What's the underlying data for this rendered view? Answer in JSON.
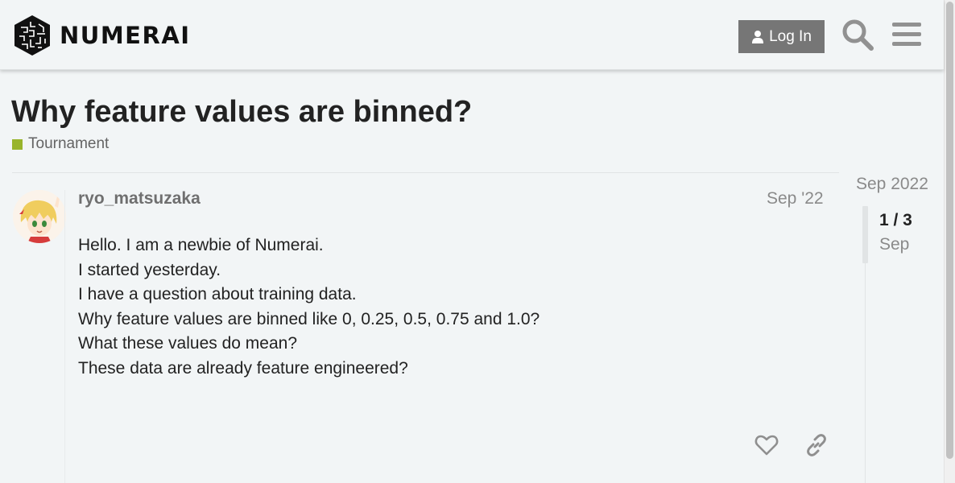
{
  "header": {
    "brand": "NUMERAI",
    "login_label": "Log In",
    "icons": {
      "login": "user-icon",
      "search": "search-icon",
      "menu": "hamburger-menu-icon"
    }
  },
  "topic": {
    "title": "Why feature values are binned?",
    "category": "Tournament",
    "category_color": "#98b42b"
  },
  "post": {
    "username": "ryo_matsuzaka",
    "date": "Sep '22",
    "body": [
      "Hello. I am a newbie of Numerai.",
      "I started yesterday.",
      "I have a question about training data.",
      "Why feature values are binned like 0, 0.25, 0.5, 0.75 and 1.0?",
      "What these values do mean?",
      "These data are already feature engineered?"
    ],
    "actions": {
      "like": "heart-icon",
      "share": "link-icon"
    }
  },
  "timeline": {
    "start_label": "Sep 2022",
    "position": "1 / 3",
    "month": "Sep"
  },
  "colors": {
    "background": "#f2f5f6",
    "button": "#767676",
    "text": "#222222",
    "muted": "#8a8a8a"
  }
}
